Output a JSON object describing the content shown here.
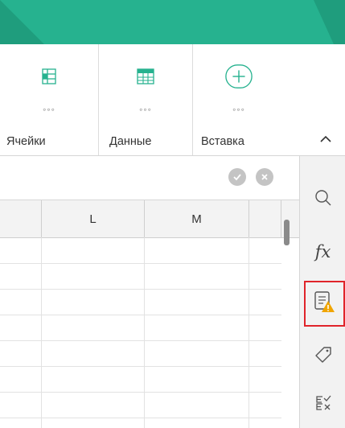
{
  "colors": {
    "top_bar": "#26b28f",
    "highlight": "#e0242a",
    "warning": "#f0a500"
  },
  "ribbon": {
    "groups": [
      {
        "label": "Ячейки",
        "icon": "cells-icon",
        "more": "◦◦◦"
      },
      {
        "label": "Данные",
        "icon": "data-table-icon",
        "more": "◦◦◦"
      },
      {
        "label": "Вставка",
        "icon": "insert-plus-icon",
        "more": "◦◦◦"
      }
    ],
    "collapse_icon": "chevron-up-icon"
  },
  "formula_bar": {
    "confirm_icon": "check-icon",
    "cancel_icon": "close-icon"
  },
  "grid": {
    "columns": [
      "",
      "L",
      "M",
      ""
    ],
    "rows": 8
  },
  "sidebar": {
    "icons": [
      "search-icon",
      "function-icon",
      "notes-warning-icon",
      "tag-icon",
      "conditional-format-icon"
    ],
    "fx_label": "fx"
  }
}
